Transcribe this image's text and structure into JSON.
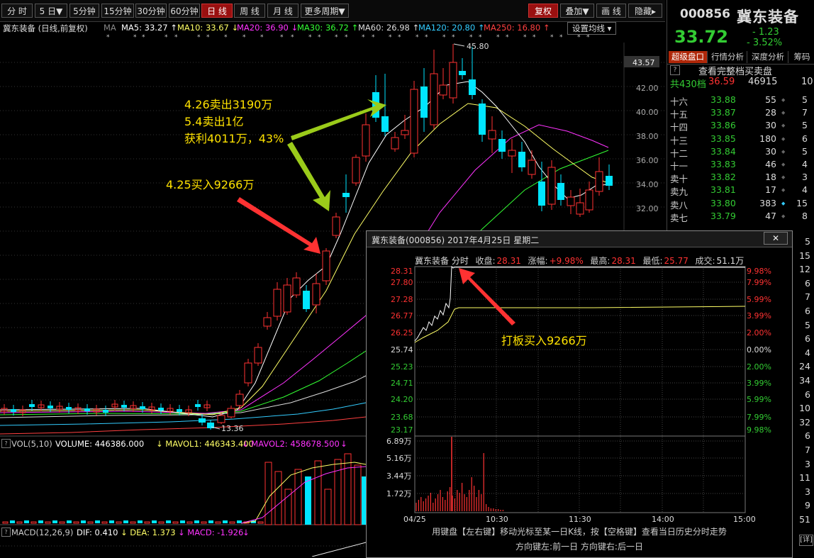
{
  "toolbar": {
    "buttons": [
      "分 时",
      "5 日▼",
      "5分钟",
      "15分钟",
      "30分钟",
      "60分钟",
      "日 线",
      "周 线",
      "月 线",
      "更多周期▼"
    ],
    "right_buttons": [
      "复权",
      "叠加▼",
      "画 线",
      "隐藏▸"
    ]
  },
  "chart_header": {
    "title": "冀东装备 (日线,前复权)",
    "ma_tag": "MA",
    "ma5": "MA5: 33.27 ↑",
    "ma10": "MA10: 33.67 ↓",
    "ma20": "MA20: 36.90 ↓",
    "ma30": "MA30: 36.72 ↑",
    "ma60": "MA60: 26.98 ↑",
    "ma120": "MA120: 20.80 ↑",
    "ma250": "MA250: 16.80 ↑",
    "setting_btn": "设置均线 ▾"
  },
  "stars": [
    "*",
    "*",
    "*",
    "*",
    "*",
    "*",
    "*",
    "*",
    "*",
    "*",
    "*",
    "*",
    "*",
    "*",
    "*",
    "*",
    "*",
    "*",
    "*",
    "*",
    "*",
    "*",
    "*",
    "*",
    "*",
    "*",
    "*",
    "*",
    "*",
    "*",
    "*",
    "*",
    "*",
    "*"
  ],
  "kchart": {
    "current_price_tag": "43.57",
    "y_labels": [
      "42.00",
      "40.00",
      "38.00",
      "36.00",
      "34.00",
      "32.00"
    ],
    "high_label": "45.80",
    "low_label": "13.36"
  },
  "annotations": {
    "sell_line1": "4.26卖出3190万",
    "sell_line2": "5.4卖出1亿",
    "sell_line3": "获利4011万，43%",
    "buy": "4.25买入9266万",
    "popup_note": "打板买入9266万"
  },
  "vol_header": {
    "label": "VOL(5,10)",
    "volume": "VOLUME: 446386.000",
    "mavol1": "↓ MAVOL1: 446343.400",
    "mavol2": "↓ MAVOL2: 458678.500",
    "arrow": "↓"
  },
  "macd_header": {
    "label": "MACD(12,26,9)",
    "dif": "DIF: 0.410",
    "dea": "↓ DEA: 1.373",
    "macd": "↓ MACD: -1.926",
    "arrow": "↓"
  },
  "right_panel": {
    "code": "000856",
    "name": "冀东装备",
    "price": "33.72",
    "change": "- 1.23",
    "pct": "- 3.52%",
    "tabs": [
      "超级盘口",
      "行情分析",
      "深度分析",
      "筹码"
    ],
    "q": "?",
    "full_book": "查看完整档买卖盘",
    "total_label": "共430档",
    "total_price": "36.59",
    "total_vol": "46915",
    "total_cnt": "10",
    "rows": [
      {
        "level": "十六",
        "price": "33.88",
        "vol": "55",
        "cnt": "5"
      },
      {
        "level": "十五",
        "price": "33.87",
        "vol": "28",
        "cnt": "7"
      },
      {
        "level": "十四",
        "price": "33.86",
        "vol": "30",
        "cnt": "5"
      },
      {
        "level": "十三",
        "price": "33.85",
        "vol": "180",
        "cnt": "6"
      },
      {
        "level": "十二",
        "price": "33.84",
        "vol": "30",
        "cnt": "5"
      },
      {
        "level": "十一",
        "price": "33.83",
        "vol": "46",
        "cnt": "4"
      },
      {
        "level": "卖十",
        "price": "33.82",
        "vol": "18",
        "cnt": "3"
      },
      {
        "level": "卖九",
        "price": "33.81",
        "vol": "17",
        "cnt": "4"
      },
      {
        "level": "卖八",
        "price": "33.80",
        "vol": "383",
        "cnt": "15"
      },
      {
        "level": "卖七",
        "price": "33.79",
        "vol": "47",
        "cnt": "8"
      }
    ],
    "partial_rows": [
      "5",
      "15",
      "12",
      "6",
      "7",
      "6",
      "5",
      "6",
      "4",
      "24",
      "34",
      "6",
      "10",
      "32",
      "6",
      "7",
      "3",
      "11",
      "3",
      "9",
      "51"
    ],
    "detail_btn": "[详]"
  },
  "popup": {
    "title": "冀东装备(000856) 2017年4月25日 星期二",
    "close": "✕",
    "info_name": "冀东装备 分时",
    "info_close_label": "收盘:",
    "info_close": "28.31",
    "info_pct_label": "涨幅:",
    "info_pct": "+9.98%",
    "info_high_label": "最高:",
    "info_high": "28.31",
    "info_low_label": "最低:",
    "info_low": "25.77",
    "info_vol_label": "成交:",
    "info_vol": "51.1万",
    "y_left": [
      "28.31",
      "27.80",
      "27.28",
      "26.77",
      "26.25",
      "25.74",
      "25.23",
      "24.71",
      "24.20",
      "23.68",
      "23.17"
    ],
    "y_right": [
      "9.98%",
      "7.99%",
      "5.99%",
      "3.99%",
      "2.00%",
      "0.00%",
      "2.00%",
      "3.99%",
      "5.99%",
      "7.99%",
      "9.98%"
    ],
    "vol_labels": [
      "6.89万",
      "5.16万",
      "3.44万",
      "1.72万"
    ],
    "x_labels": [
      "04/25",
      "10:30",
      "11:30",
      "14:00",
      "15:00"
    ],
    "hint1": "用键盘【左右键】移动光标至某一日K线，按【空格键】查看当日历史分时走势",
    "hint2": "方向键左:前一日    方向键右:后一日"
  },
  "colors": {
    "up": "#ff3232",
    "down": "#00e5ff",
    "ma5": "#ffffff",
    "ma10": "#ffff66",
    "ma20": "#ff33ff",
    "ma30": "#33ff33",
    "ma60": "#ffffff",
    "ma120": "#33ccff",
    "ma250": "#ff4040",
    "annotation": "#ffe200",
    "green": "#33cc33"
  }
}
